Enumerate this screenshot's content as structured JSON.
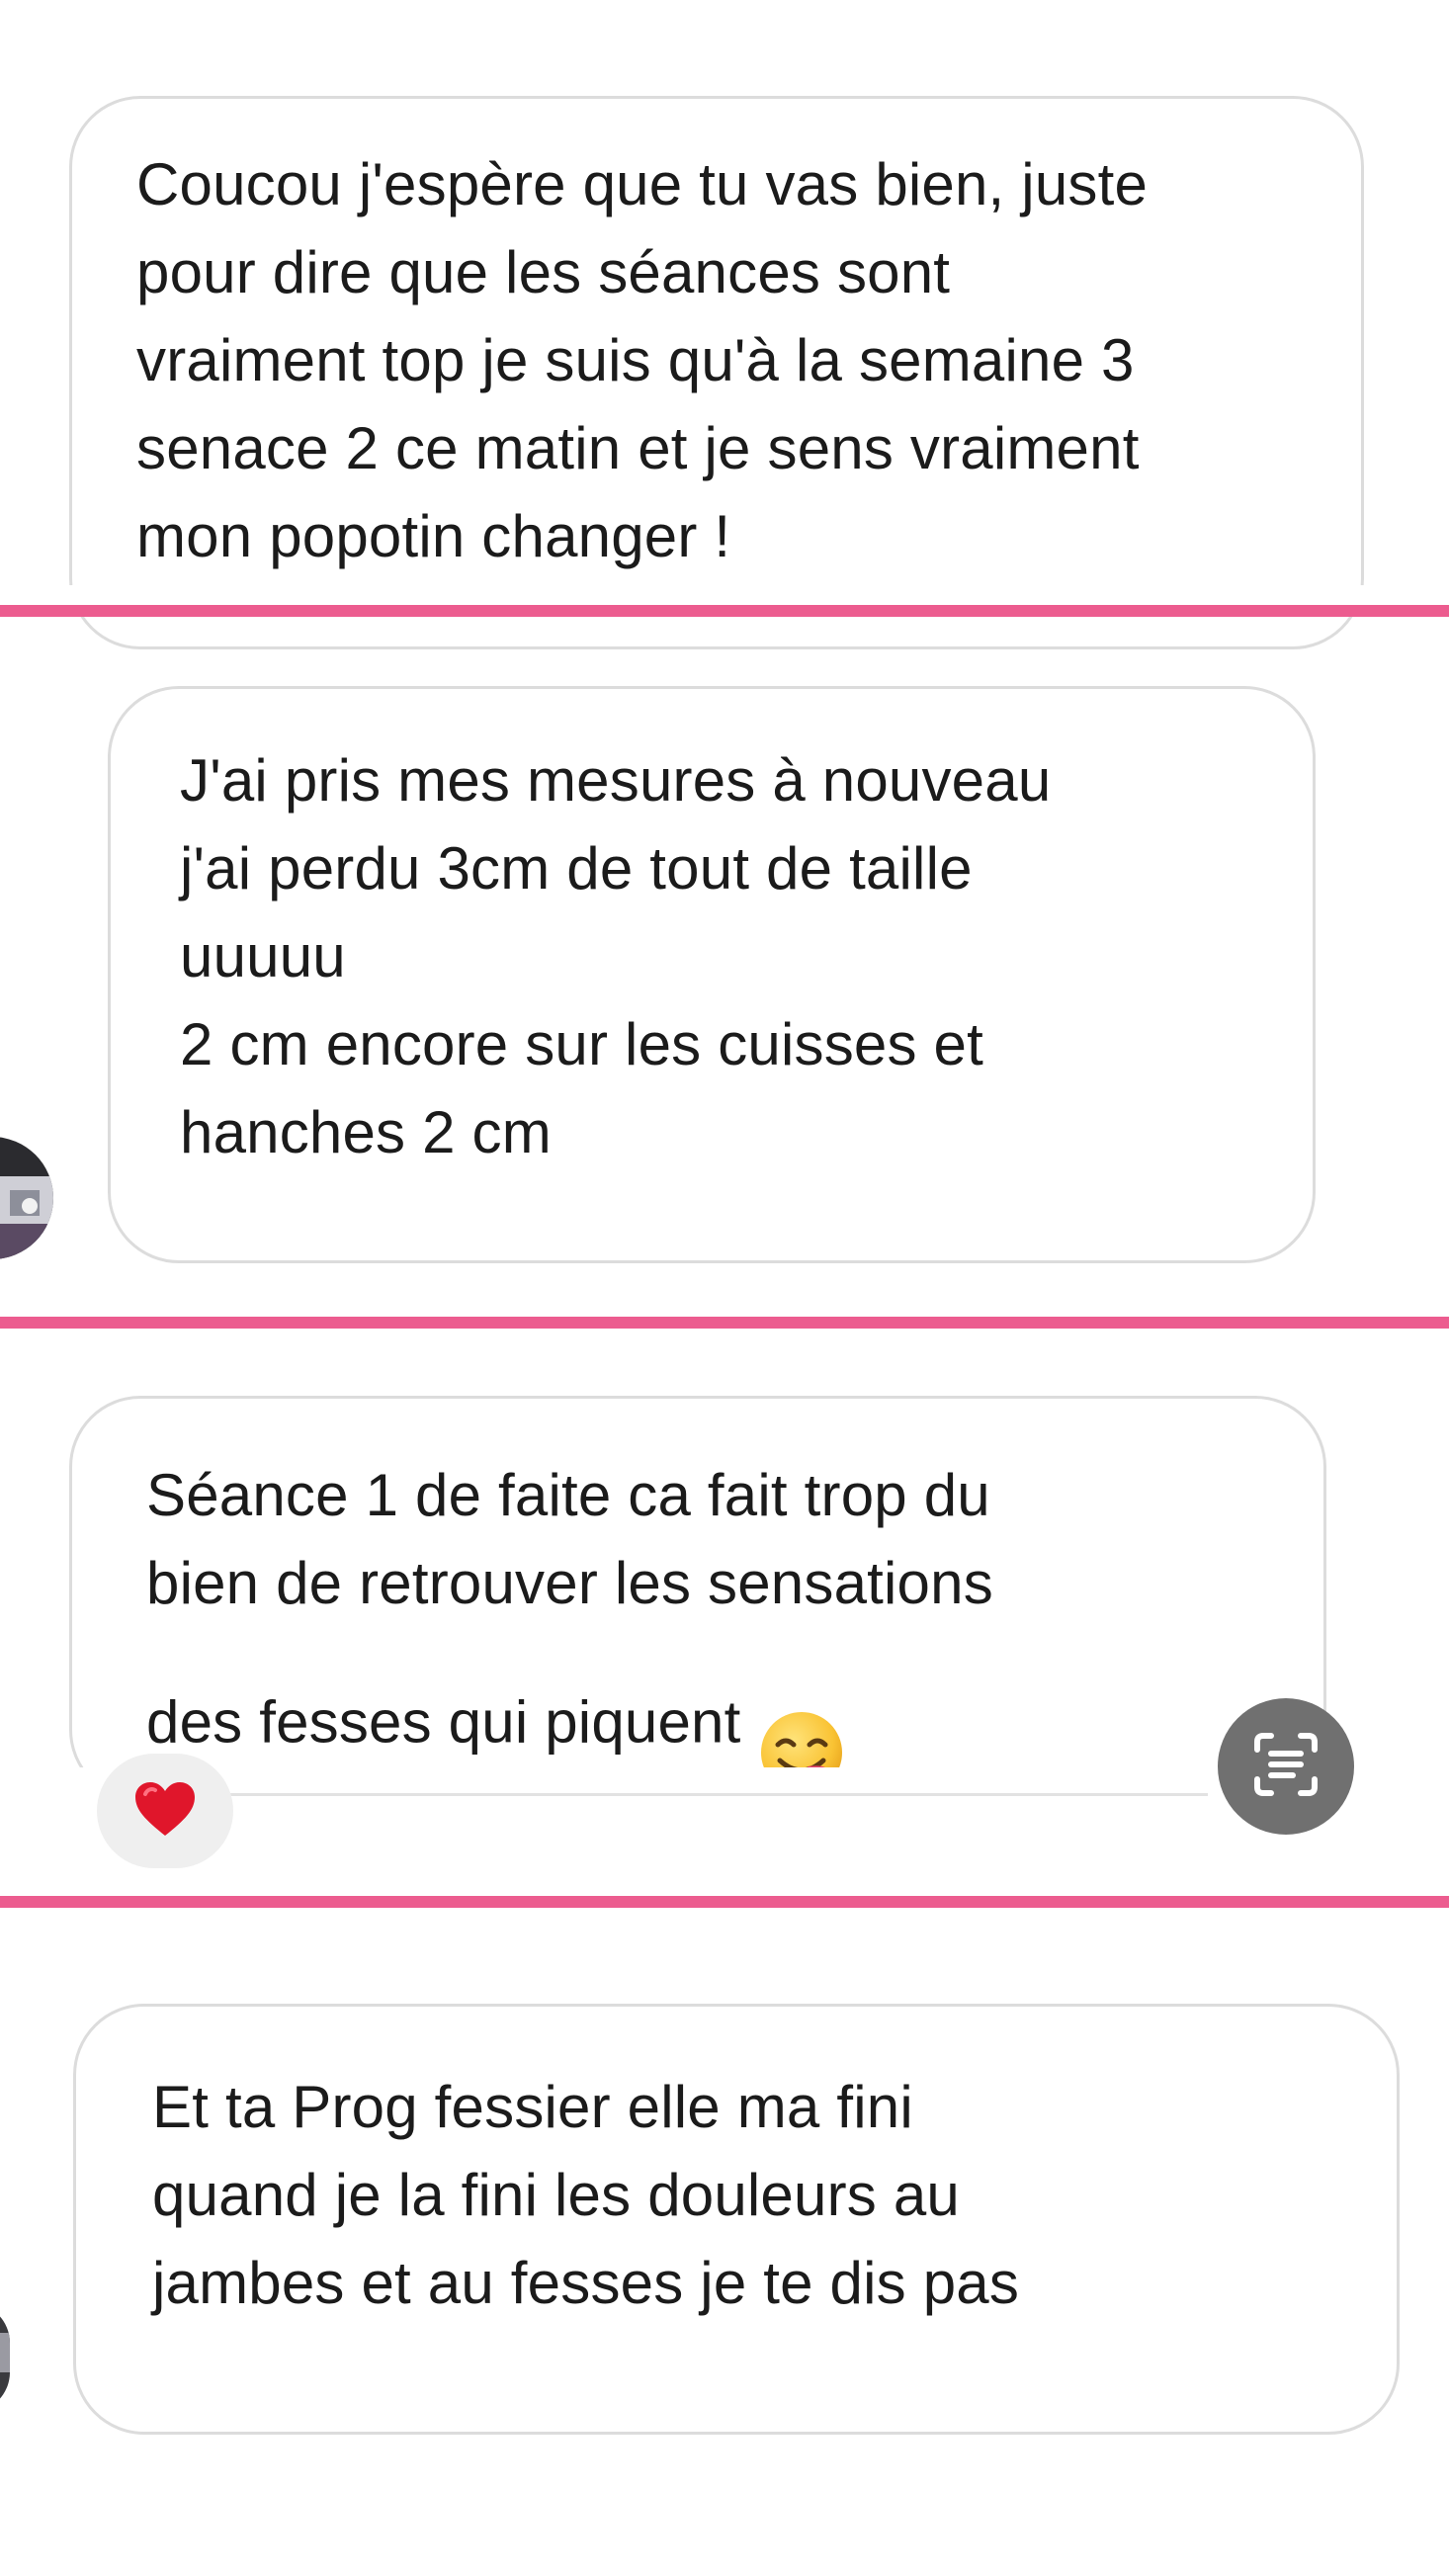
{
  "messages": [
    {
      "text": "Coucou j'espère que tu vas bien, juste\npour dire que les séances sont\nvraiment top je suis qu'à la semaine 3\nsenace 2 ce matin et je sens vraiment\nmon popotin changer !"
    },
    {
      "text": "J'ai pris mes mesures à nouveau\nj'ai perdu 3cm de tout de taille\nuuuuu\n2 cm encore sur les cuisses et\nhanches 2 cm"
    },
    {
      "text": "Séance 1 de faite ca fait trop du\nbien de retrouver les sensations\ndes fesses qui piquent",
      "emoji": "smiling-face-savoring-food-icon",
      "reaction": "red-heart-icon"
    },
    {
      "text": "Et ta Prog fessier elle ma fini\nquand je la fini les douleurs au\njambes et au fesses je te dis pas"
    }
  ],
  "colors": {
    "divider": "#ec5c8f",
    "bubble_border": "#dcdcdc",
    "scan_button": "#707070",
    "reaction_bg": "#efefef"
  },
  "icons": {
    "live_text_scan": "text-scan-icon",
    "reaction": "red-heart-icon"
  }
}
